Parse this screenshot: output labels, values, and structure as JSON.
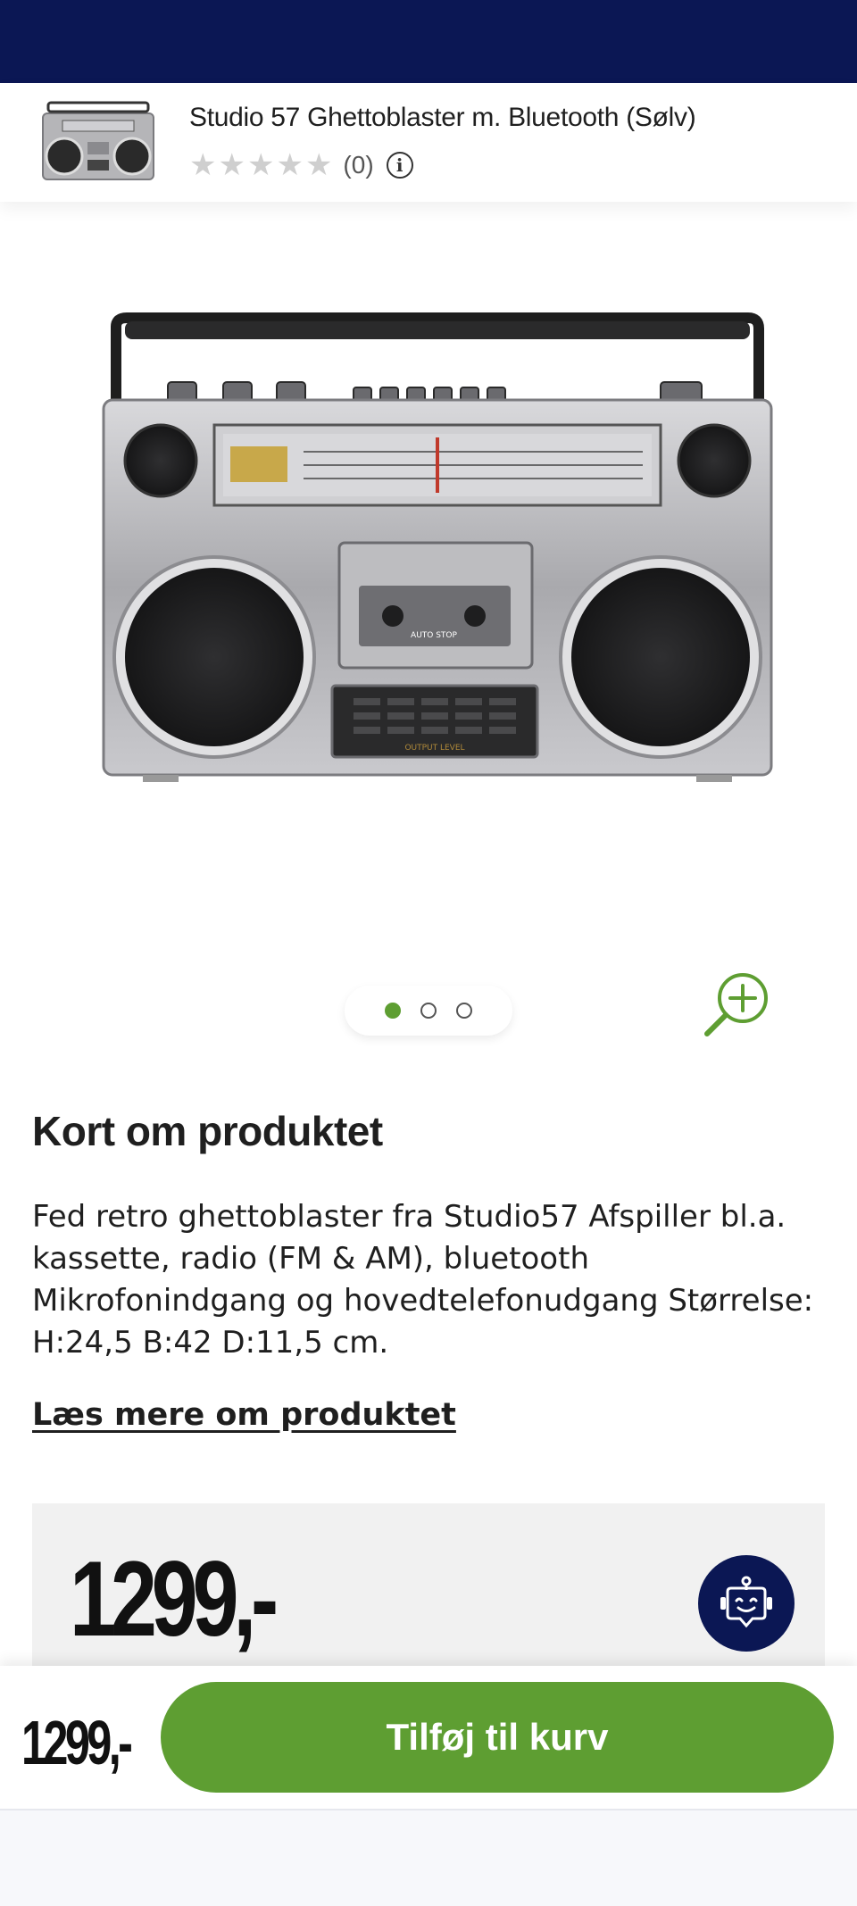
{
  "header": {
    "product_title": "Studio 57 Ghettoblaster m. Bluetooth (Sølv)",
    "rating_count": "(0)",
    "stars_filled": 0,
    "stars_total": 5
  },
  "gallery": {
    "image_count": 3,
    "active_index": 0,
    "image_labels": [
      "AUTO STOP",
      "OUTPUT LEVEL"
    ]
  },
  "about": {
    "title": "Kort om produktet",
    "description": "Fed retro ghettoblaster fra Studio57 Afspiller bl.a. kassette, radio (FM & AM), bluetooth Mikrofonindgang og hovedtelefonudgang Størrelse: H:24,5 B:42 D:11,5 cm.",
    "read_more": "Læs mere om produktet"
  },
  "price": {
    "amount": "1299,-"
  },
  "bottom_bar": {
    "price": "1299,-",
    "add_to_cart": "Tilføj til kurv"
  },
  "colors": {
    "navy": "#0b1754",
    "green": "#5e9e32",
    "star_empty": "#cfcfcf"
  },
  "icons": [
    "info-icon",
    "zoom-in-icon",
    "chatbot-icon",
    "star-icon"
  ]
}
